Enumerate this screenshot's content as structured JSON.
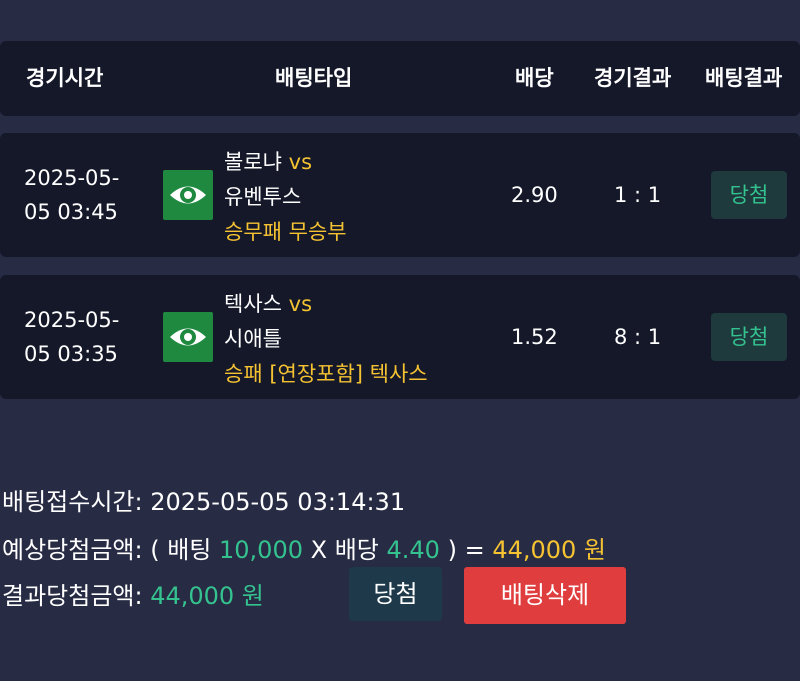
{
  "header": {
    "time": "경기시간",
    "type": "배팅타입",
    "odds": "배당",
    "game_result": "경기결과",
    "bet_result": "배팅결과"
  },
  "bets": [
    {
      "time_line1": "2025-05-",
      "time_line2": "05 03:45",
      "home": "볼로냐",
      "vs": "vs",
      "away": "유벤투스",
      "market": "승무패 무승부",
      "odds": "2.90",
      "score": "1 : 1",
      "result": "당첨",
      "icon": "eye-icon"
    },
    {
      "time_line1": "2025-05-",
      "time_line2": "05 03:35",
      "home": "텍사스",
      "vs": "vs",
      "away": "시애틀",
      "market": "승패 [연장포함] 텍사스",
      "odds": "1.52",
      "score": "8 : 1",
      "result": "당첨",
      "icon": "eye-icon"
    }
  ],
  "summary": {
    "received_label": "배팅접수시간",
    "received_value": "2025-05-05 03:14:31",
    "expected_label": "예상당첨금액",
    "paren_open": "( 배팅",
    "bet_amount": "10,000",
    "times_odds": "X 배당",
    "total_odds": "4.40",
    "paren_close": ") =",
    "expected_amount": "44,000 원",
    "result_label": "결과당첨금액",
    "result_amount": "44,000 원"
  },
  "buttons": {
    "win": "당첨",
    "delete": "배팅삭제"
  },
  "colors": {
    "background": "#272b44",
    "panel": "#141829",
    "accent_yellow": "#f5c232",
    "accent_green": "#34c38f",
    "delete_red": "#e03e3e",
    "eye_green": "#1f8a3f"
  }
}
